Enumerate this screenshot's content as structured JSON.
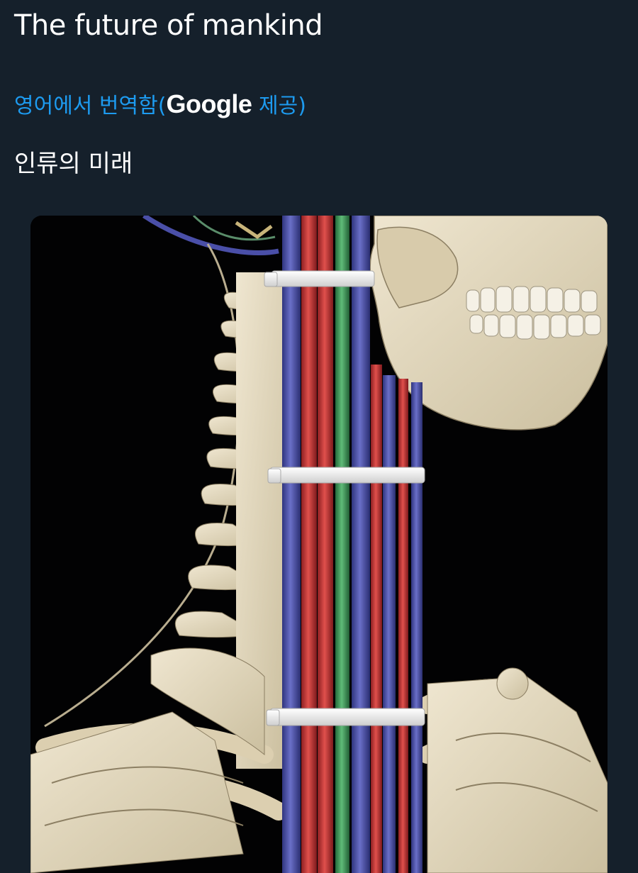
{
  "tweet": {
    "text": "The future of mankind"
  },
  "translation": {
    "prefix": "영어에서 번역함(",
    "provider": "Google",
    "suffix": " 제공)",
    "translated_text": "인류의 미래"
  },
  "media": {
    "type": "image",
    "description_icon": "skeleton-with-cable-spine"
  },
  "colors": {
    "background": "#15202b",
    "link": "#1d9bf0",
    "text": "#ffffff",
    "bone": "#e7dcc4",
    "cable_blue": "#4a4fa8",
    "cable_red": "#c8393a",
    "cable_green": "#3f9a5a",
    "zip_tie": "#ececec"
  }
}
